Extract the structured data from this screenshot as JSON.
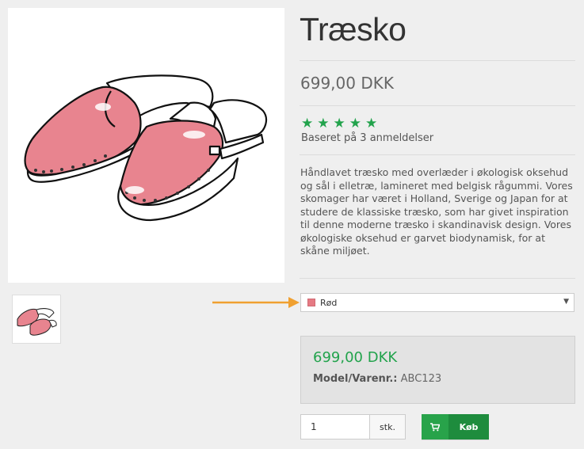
{
  "product": {
    "title": "Træsko",
    "price": "699,00 DKK",
    "rating": {
      "stars": 5,
      "max": 5,
      "reviews_text": "Baseret på 3 anmeldelser"
    },
    "description": "Håndlavet træsko med overlæder i økologisk oksehud og sål i elletræ, lamineret med belgisk rågummi. Vores skomager har været i Holland, Sverige og Japan for at studere de klassiske træsko, som har givet inspiration til denne moderne træsko i skandinavisk design. Vores økologiske oksehud er garvet biodynamisk, for at skåne miljøet."
  },
  "option": {
    "selected_label": "Rød",
    "swatch_color": "#e57a83"
  },
  "pricebox": {
    "price": "699,00 DKK",
    "model_label": "Model/Varenr.:",
    "model_value": "ABC123"
  },
  "cart": {
    "quantity": "1",
    "unit": "stk.",
    "buy_label": "Køb"
  },
  "colors": {
    "accent_green": "#22a34c",
    "buy_dark": "#1e8c3d",
    "arrow_orange": "#f0a030",
    "shoe_pink": "#e8848f"
  },
  "icons": {
    "cart": "cart-icon",
    "caret": "chevron-down-icon",
    "star": "star-icon"
  }
}
